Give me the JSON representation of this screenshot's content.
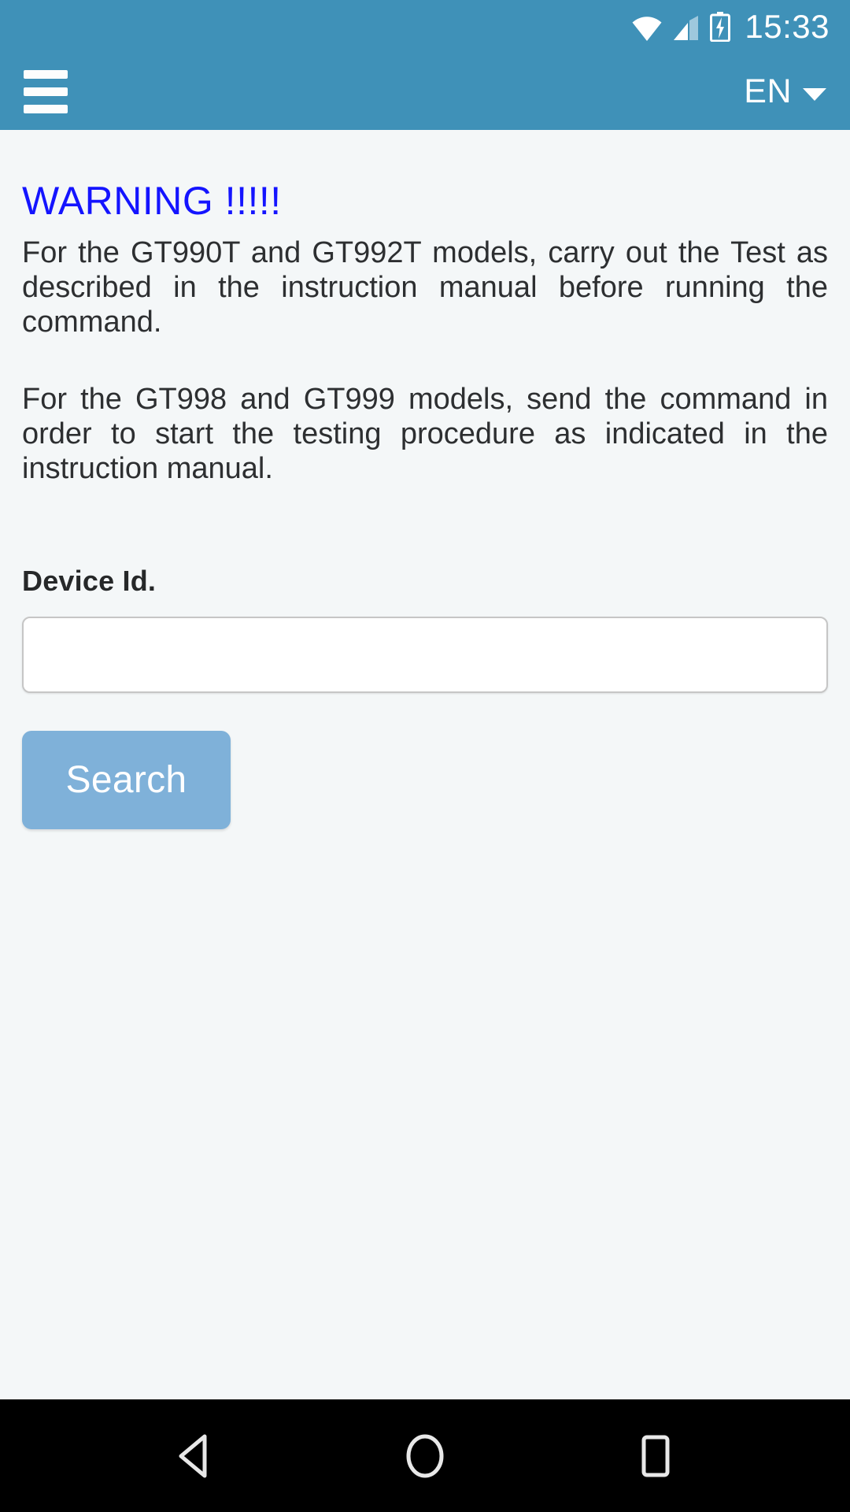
{
  "status_bar": {
    "time": "15:33",
    "icons": [
      "wifi-icon",
      "cell-signal-icon",
      "battery-charging-icon"
    ]
  },
  "app_bar": {
    "menu_icon": "hamburger-menu-icon",
    "language": "EN",
    "caret_icon": "chevron-down-icon"
  },
  "main": {
    "warning_title": "WARNING !!!!!",
    "paragraph_1": "For the GT990T and GT992T models, carry out the Test as described in the instruction manual before running the command.",
    "paragraph_2": "For the GT998 and GT999 models, send the command in order to start the testing procedure as indicated in the instruction manual.",
    "device_id_label": "Device Id.",
    "device_id_value": "",
    "device_id_placeholder": "",
    "search_label": "Search"
  },
  "nav_bar": {
    "back": "back-icon",
    "home": "home-icon",
    "recents": "recents-icon"
  },
  "colors": {
    "header_blue": "#3f91b8",
    "page_background": "#f4f7f8",
    "warning_blue": "#1414ff",
    "button_blue": "#7fb1d9",
    "nav_black": "#000000"
  }
}
